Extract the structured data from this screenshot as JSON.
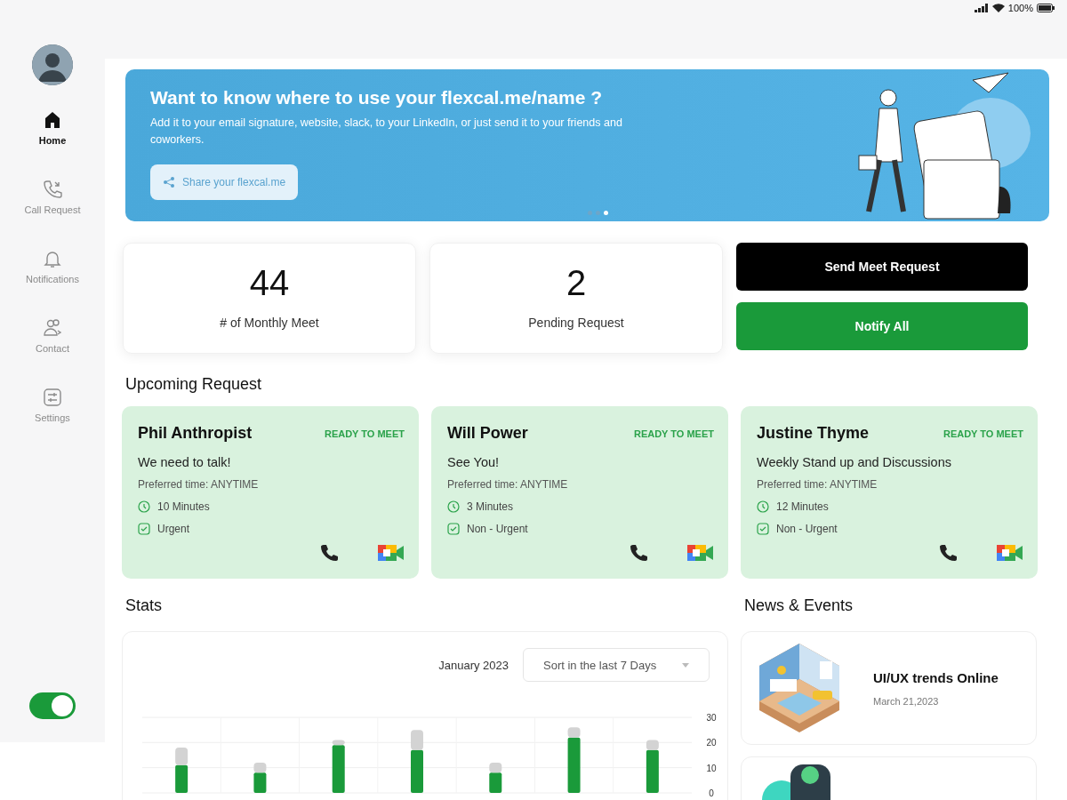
{
  "status_bar": {
    "battery": "100%"
  },
  "sidebar": {
    "nav": [
      {
        "label": "Home",
        "selected": true
      },
      {
        "label": "Call Request",
        "selected": false
      },
      {
        "label": "Notifications",
        "selected": false
      },
      {
        "label": "Contact",
        "selected": false
      },
      {
        "label": "Settings",
        "selected": false
      }
    ],
    "toggle": {
      "on": true
    }
  },
  "banner": {
    "title": "Want to know where to use your flexcal.me/name ?",
    "text": "Add it to your email signature, website, slack, to your LinkedIn, or just send it to your friends and coworkers.",
    "button": "Share your flexcal.me",
    "pager": [
      {
        "selected": false
      },
      {
        "selected": false
      },
      {
        "selected": true
      }
    ]
  },
  "stat_cards": [
    {
      "value": "44",
      "label": "# of Monthly Meet"
    },
    {
      "value": "2",
      "label": "Pending Request"
    }
  ],
  "actions": [
    {
      "label": "Send Meet Request",
      "kind": "dark"
    },
    {
      "label": "Notify All",
      "kind": "green"
    }
  ],
  "upcoming": {
    "title": "Upcoming Request",
    "requests": [
      {
        "name": "Phil Anthropist",
        "status": "READY TO MEET",
        "message": "We need to talk!",
        "preferred": "Preferred time: ANYTIME",
        "duration": "10 Minutes",
        "priority": "Urgent"
      },
      {
        "name": "Will Power",
        "status": "READY TO MEET",
        "message": "See You!",
        "preferred": "Preferred time: ANYTIME",
        "duration": "3 Minutes",
        "priority": "Non - Urgent"
      },
      {
        "name": "Justine Thyme",
        "status": "READY TO MEET",
        "message": "Weekly Stand up and Discussions",
        "preferred": "Preferred time: ANYTIME",
        "duration": "12 Minutes",
        "priority": "Non - Urgent"
      }
    ]
  },
  "stats": {
    "title": "Stats",
    "month": "January 2023",
    "sort": "Sort in the last 7 Days",
    "chart_data": {
      "type": "bar",
      "stacked": true,
      "ylim": [
        0,
        30
      ],
      "yticks": [
        0,
        10,
        20,
        30
      ],
      "series": [
        {
          "color": "#1a9a3a",
          "values": [
            11,
            8,
            19,
            17,
            8,
            22,
            17
          ]
        },
        {
          "color": "#d3d3d3",
          "values": [
            7,
            4,
            2,
            8,
            4,
            4,
            4
          ]
        }
      ]
    }
  },
  "news": {
    "title": "News & Events",
    "items": [
      {
        "kind": "picture",
        "title": "UI/UX trends Online",
        "date": "March 21,2023"
      },
      {
        "kind": "picture"
      }
    ]
  }
}
